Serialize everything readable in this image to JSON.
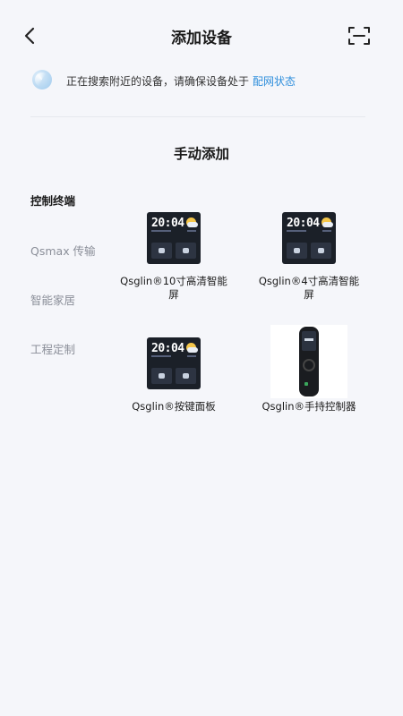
{
  "header": {
    "title": "添加设备",
    "back_icon": "chevron-left-icon",
    "scan_icon": "scan-icon"
  },
  "search": {
    "text": "正在搜索附近的设备，请确保设备处于",
    "link": "配网状态",
    "link_color": "#2f8fdc"
  },
  "manual": {
    "title": "手动添加"
  },
  "categories": [
    {
      "label": "控制终端",
      "active": true
    },
    {
      "label": "Qsmax 传输",
      "active": false
    },
    {
      "label": "智能家居",
      "active": false
    },
    {
      "label": "工程定制",
      "active": false
    }
  ],
  "devices": [
    {
      "label": "Qsglin®10寸高清智能屏",
      "screen_time": "20:04"
    },
    {
      "label": "Qsglin®4寸高清智能屏",
      "screen_time": "20:04"
    },
    {
      "label": "Qsglin®按键面板",
      "screen_time": "20:04"
    },
    {
      "label": "Qsglin®手持控制器"
    }
  ]
}
